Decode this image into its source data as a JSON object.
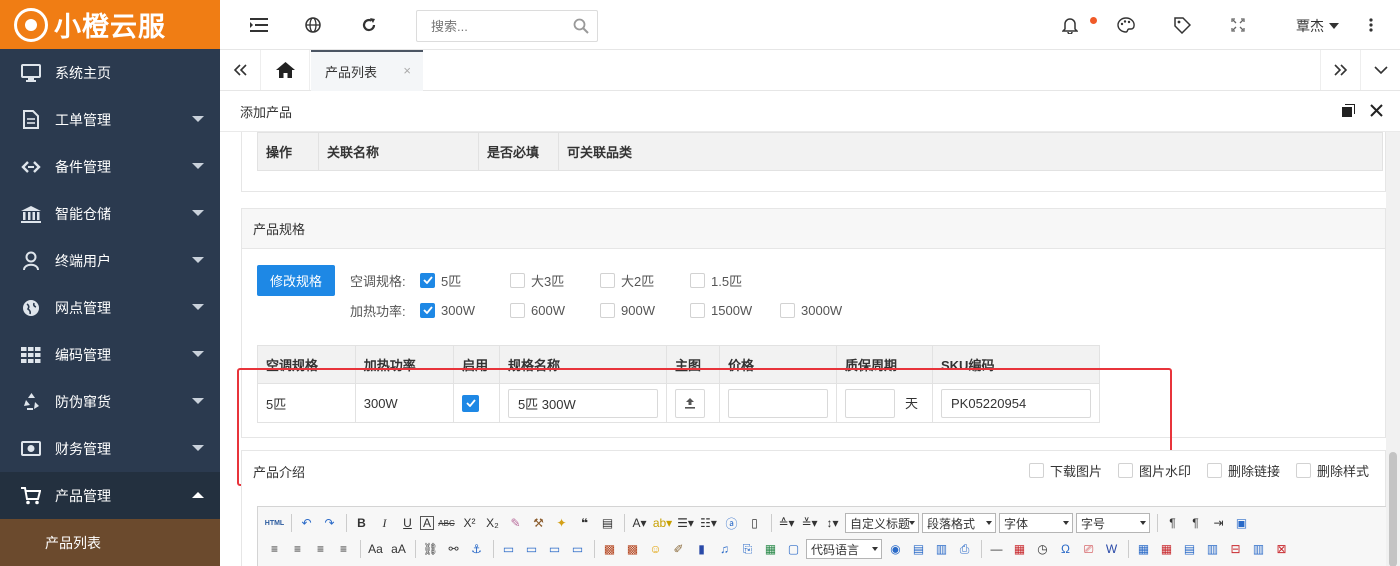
{
  "app": {
    "name": "小橙云服"
  },
  "sidebar": {
    "items": [
      {
        "label": "系统主页",
        "icon": "monitor-icon"
      },
      {
        "label": "工单管理",
        "icon": "document-icon"
      },
      {
        "label": "备件管理",
        "icon": "link-icon"
      },
      {
        "label": "智能仓储",
        "icon": "bank-icon"
      },
      {
        "label": "终端用户",
        "icon": "user-icon"
      },
      {
        "label": "网点管理",
        "icon": "globe-icon"
      },
      {
        "label": "编码管理",
        "icon": "grid-icon"
      },
      {
        "label": "防伪窜货",
        "icon": "recycle-icon"
      },
      {
        "label": "财务管理",
        "icon": "money-icon"
      },
      {
        "label": "产品管理",
        "icon": "cart-icon"
      }
    ],
    "sub_item": "产品列表"
  },
  "topbar": {
    "search_placeholder": "搜索...",
    "user": "覃杰"
  },
  "tabs": {
    "active": "产品列表",
    "close": "×"
  },
  "panel": {
    "title": "添加产品"
  },
  "related": {
    "headers": [
      "操作",
      "关联名称",
      "是否必填",
      "可关联品类"
    ]
  },
  "spec": {
    "title": "产品规格",
    "modify_button": "修改规格",
    "ac_label": "空调规格:",
    "ac_options": [
      {
        "label": "5匹",
        "checked": true
      },
      {
        "label": "大3匹",
        "checked": false
      },
      {
        "label": "大2匹",
        "checked": false
      },
      {
        "label": "1.5匹",
        "checked": false
      }
    ],
    "power_label": "加热功率:",
    "power_options": [
      {
        "label": "300W",
        "checked": true
      },
      {
        "label": "600W",
        "checked": false
      },
      {
        "label": "900W",
        "checked": false
      },
      {
        "label": "1500W",
        "checked": false
      },
      {
        "label": "3000W",
        "checked": false
      }
    ],
    "table_headers": [
      "空调规格",
      "加热功率",
      "启用",
      "规格名称",
      "主图",
      "价格",
      "质保周期",
      "SKU编码"
    ],
    "row": {
      "ac": "5匹",
      "power": "300W",
      "enabled": true,
      "name": "5匹 300W",
      "price": "",
      "warranty": "",
      "warranty_unit": "天",
      "sku": "PK05220954"
    }
  },
  "intro": {
    "title": "产品介绍",
    "options": [
      "下载图片",
      "图片水印",
      "删除链接",
      "删除样式"
    ],
    "editor": {
      "custom_title": "自定义标题",
      "paragraph": "段落格式",
      "font": "字体",
      "size": "字号",
      "code_lang": "代码语言"
    }
  },
  "colors": {
    "brand": "#f07d14",
    "sidebar": "#2b3a4f",
    "primary": "#1e88e5",
    "highlight": "#e8343b",
    "submenu": "#6b4a2d"
  }
}
